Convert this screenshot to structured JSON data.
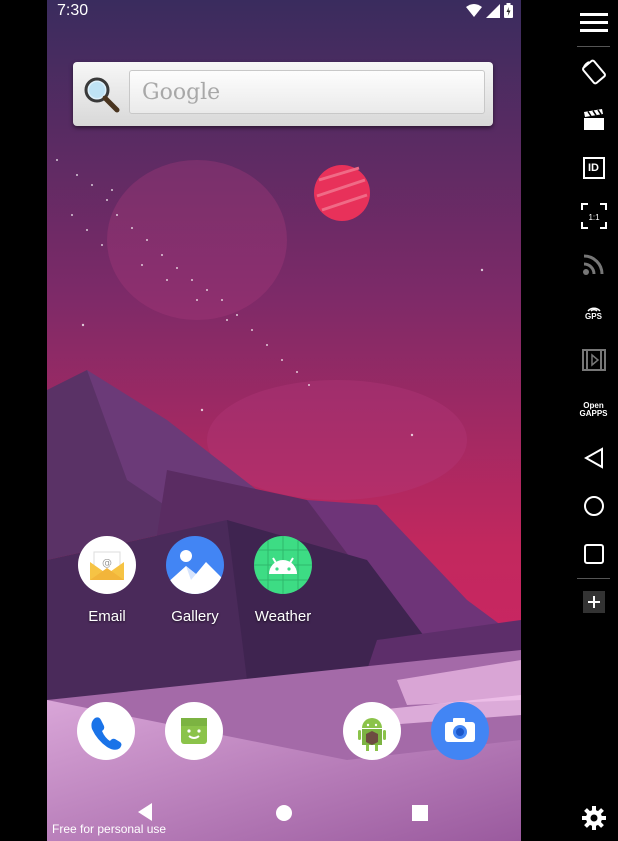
{
  "status_bar": {
    "time": "7:30"
  },
  "search_widget": {
    "placeholder": "Google"
  },
  "apps": [
    {
      "label": "Email"
    },
    {
      "label": "Gallery"
    },
    {
      "label": "Weather"
    }
  ],
  "dock": [
    "phone",
    "messaging",
    "android",
    "camera"
  ],
  "watermark": "Free for personal use",
  "sidebar": {
    "tools": [
      "menu",
      "rotate",
      "screen-record",
      "identifiers",
      "pixel-perfect",
      "cast",
      "gps",
      "media",
      "open-gapps",
      "back",
      "home",
      "recents",
      "add",
      "settings"
    ],
    "gps_label": "GPS",
    "opengapps_label": "Open\nGAPPS",
    "identifiers_label": "ID",
    "pixel_label": "1:1"
  },
  "colors": {
    "wallpaper_top": "#3a2c5e",
    "wallpaper_mid": "#c2285e",
    "planet": "#e8315a",
    "mountain": "#4a2a5a",
    "camera_blue": "#4285f4",
    "weather_green": "#3ddc84"
  }
}
